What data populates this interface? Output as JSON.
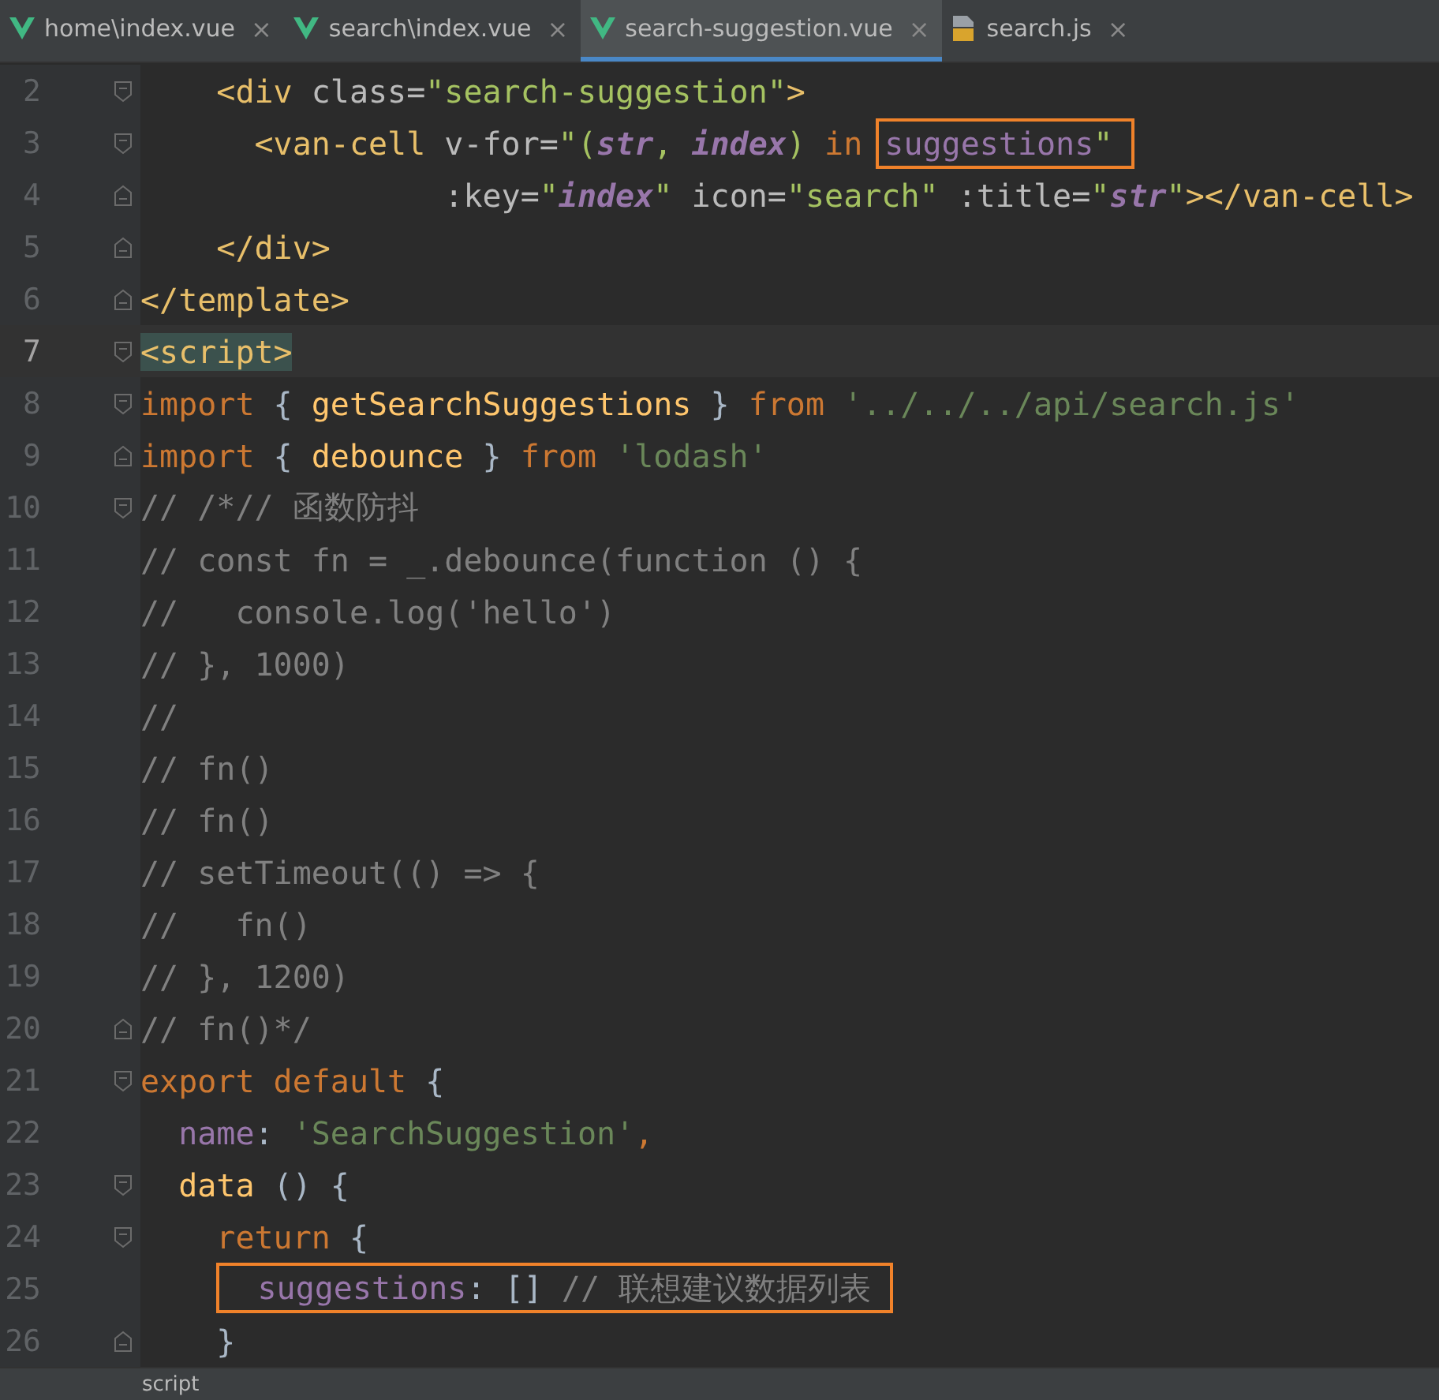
{
  "tabs": [
    {
      "label": "home\\index.vue",
      "kind": "vue",
      "selected": false,
      "close": "×"
    },
    {
      "label": "search\\index.vue",
      "kind": "vue",
      "selected": false,
      "close": "×"
    },
    {
      "label": "search-suggestion.vue",
      "kind": "vue",
      "selected": true,
      "close": "×"
    },
    {
      "label": "search.js",
      "kind": "js",
      "selected": false,
      "close": "×"
    }
  ],
  "lines": [
    {
      "number": "2",
      "fold": {
        "kind": "start"
      },
      "current": false,
      "tokens": [
        {
          "text": "    <div ",
          "kind": "tag"
        },
        {
          "text": "class=",
          "kind": "attr"
        },
        {
          "text": "\"search-suggestion\"",
          "kind": "string"
        },
        {
          "text": ">",
          "kind": "tag"
        }
      ]
    },
    {
      "number": "3",
      "fold": {
        "kind": "start"
      },
      "current": false,
      "tokens": [
        {
          "text": "      <van-cell ",
          "kind": "tag"
        },
        {
          "text": "v-for=",
          "kind": "attr"
        },
        {
          "text": "\"(",
          "kind": "string"
        },
        {
          "text": "str",
          "kind": "var"
        },
        {
          "text": ", ",
          "kind": "string"
        },
        {
          "text": "index",
          "kind": "var"
        },
        {
          "text": ") ",
          "kind": "string"
        },
        {
          "text": "in ",
          "kind": "keyword"
        }
      ],
      "boxed": [
        {
          "text": "suggestions",
          "kind": "prop"
        },
        {
          "text": "\"",
          "kind": "string"
        }
      ]
    },
    {
      "number": "4",
      "fold": {
        "kind": "end"
      },
      "current": false,
      "tokens": [
        {
          "text": "                :key=",
          "kind": "attr"
        },
        {
          "text": "\"",
          "kind": "string"
        },
        {
          "text": "index",
          "kind": "var"
        },
        {
          "text": "\" ",
          "kind": "string"
        },
        {
          "text": "icon=",
          "kind": "attr"
        },
        {
          "text": "\"search\" ",
          "kind": "string"
        },
        {
          "text": ":title=",
          "kind": "attr"
        },
        {
          "text": "\"",
          "kind": "string"
        },
        {
          "text": "str",
          "kind": "var"
        },
        {
          "text": "\"",
          "kind": "string"
        },
        {
          "text": "></van-cell>",
          "kind": "tag"
        }
      ]
    },
    {
      "number": "5",
      "fold": {
        "kind": "end"
      },
      "current": false,
      "tokens": [
        {
          "text": "    </div>",
          "kind": "tag"
        }
      ]
    },
    {
      "number": "6",
      "fold": {
        "kind": "end"
      },
      "current": false,
      "tokens": [
        {
          "text": "</template>",
          "kind": "tag"
        }
      ]
    },
    {
      "number": "7",
      "fold": {
        "kind": "start"
      },
      "current": true,
      "tokens": [
        {
          "text": "<script>",
          "kind": "tag",
          "matched": true
        }
      ]
    },
    {
      "number": "8",
      "fold": {
        "kind": "start"
      },
      "current": false,
      "tokens": [
        {
          "text": "import ",
          "kind": "keyword"
        },
        {
          "text": "{ "
        },
        {
          "text": "getSearchSuggestions",
          "kind": "ident"
        },
        {
          "text": " } "
        },
        {
          "text": "from ",
          "kind": "keyword"
        },
        {
          "text": "'../../../api/search.js'",
          "kind": "jsstring"
        }
      ]
    },
    {
      "number": "9",
      "fold": {
        "kind": "end"
      },
      "current": false,
      "tokens": [
        {
          "text": "import ",
          "kind": "keyword"
        },
        {
          "text": "{ "
        },
        {
          "text": "debounce",
          "kind": "ident"
        },
        {
          "text": " } "
        },
        {
          "text": "from ",
          "kind": "keyword"
        },
        {
          "text": "'lodash'",
          "kind": "jsstring"
        }
      ]
    },
    {
      "number": "10",
      "fold": {
        "kind": "start"
      },
      "current": false,
      "tokens": [
        {
          "text": "// /*// 函数防抖",
          "kind": "comment"
        }
      ]
    },
    {
      "number": "11",
      "current": false,
      "tokens": [
        {
          "text": "// const fn = _.debounce(function () {",
          "kind": "comment"
        }
      ]
    },
    {
      "number": "12",
      "current": false,
      "tokens": [
        {
          "text": "//   console.log('hello')",
          "kind": "comment"
        }
      ]
    },
    {
      "number": "13",
      "current": false,
      "tokens": [
        {
          "text": "// }, 1000)",
          "kind": "comment"
        }
      ]
    },
    {
      "number": "14",
      "current": false,
      "tokens": [
        {
          "text": "//",
          "kind": "comment"
        }
      ]
    },
    {
      "number": "15",
      "current": false,
      "tokens": [
        {
          "text": "// fn()",
          "kind": "comment"
        }
      ]
    },
    {
      "number": "16",
      "current": false,
      "tokens": [
        {
          "text": "// fn()",
          "kind": "comment"
        }
      ]
    },
    {
      "number": "17",
      "current": false,
      "tokens": [
        {
          "text": "// setTimeout(() => {",
          "kind": "comment"
        }
      ]
    },
    {
      "number": "18",
      "current": false,
      "tokens": [
        {
          "text": "//   fn()",
          "kind": "comment"
        }
      ]
    },
    {
      "number": "19",
      "current": false,
      "tokens": [
        {
          "text": "// }, 1200)",
          "kind": "comment"
        }
      ]
    },
    {
      "number": "20",
      "fold": {
        "kind": "end"
      },
      "current": false,
      "tokens": [
        {
          "text": "// fn()*/",
          "kind": "comment"
        }
      ]
    },
    {
      "number": "21",
      "fold": {
        "kind": "start"
      },
      "current": false,
      "tokens": [
        {
          "text": "export default ",
          "kind": "keyword"
        },
        {
          "text": "{"
        }
      ]
    },
    {
      "number": "22",
      "current": false,
      "tokens": [
        {
          "text": "  name",
          "kind": "prop"
        },
        {
          "text": ": "
        },
        {
          "text": "'SearchSuggestion'",
          "kind": "jsstring"
        },
        {
          "text": ",",
          "kind": "keyword"
        }
      ]
    },
    {
      "number": "23",
      "fold": {
        "kind": "start"
      },
      "current": false,
      "tokens": [
        {
          "text": "  data",
          "kind": "ident"
        },
        {
          "text": " () {"
        }
      ]
    },
    {
      "number": "24",
      "fold": {
        "kind": "start"
      },
      "current": false,
      "tokens": [
        {
          "text": "    return ",
          "kind": "keyword"
        },
        {
          "text": "{"
        }
      ]
    },
    {
      "number": "25",
      "current": false,
      "boxed": [
        {
          "text": "  suggestions",
          "kind": "prop"
        },
        {
          "text": ": [] "
        },
        {
          "text": "// 联想建议数据列表",
          "kind": "comment"
        }
      ]
    },
    {
      "number": "26",
      "fold": {
        "kind": "end"
      },
      "current": false,
      "tokens": [
        {
          "text": "    }"
        }
      ]
    }
  ],
  "status_bar": {
    "breadcrumb": "script"
  }
}
